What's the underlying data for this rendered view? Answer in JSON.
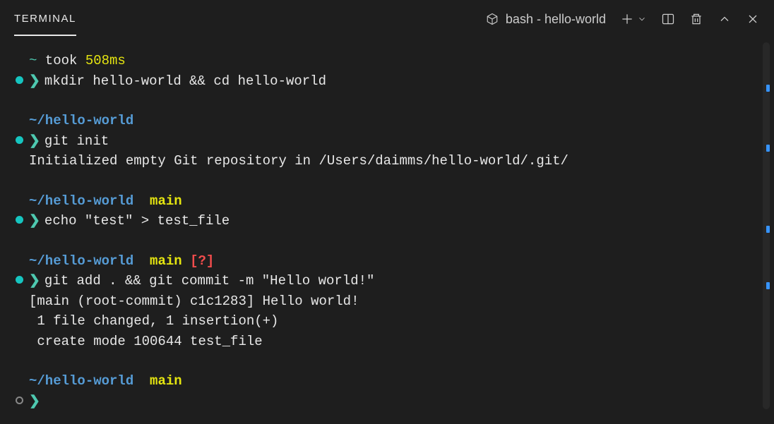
{
  "header": {
    "tab_label": "TERMINAL",
    "shell_label": "bash - hello-world"
  },
  "lines": {
    "l1_tilde": "~",
    "l1_took": " took ",
    "l1_time": "508ms",
    "l2_cmd": "mkdir hello-world && cd hello-world",
    "l3_path": "~/hello-world",
    "l4_cmd": "git init",
    "l5_out": "Initialized empty Git repository in /Users/daimms/hello-world/.git/",
    "l6_path": "~/hello-world",
    "l6_branch": "main",
    "l7_cmd": "echo \"test\" > test_file",
    "l8_path": "~/hello-world",
    "l8_branch": "main",
    "l8_status": "[?]",
    "l9_cmd": "git add . && git commit -m \"Hello world!\"",
    "l10_out": "[main (root-commit) c1c1283] Hello world!",
    "l11_out": " 1 file changed, 1 insertion(+)",
    "l12_out": " create mode 100644 test_file",
    "l13_path": "~/hello-world",
    "l13_branch": "main"
  }
}
